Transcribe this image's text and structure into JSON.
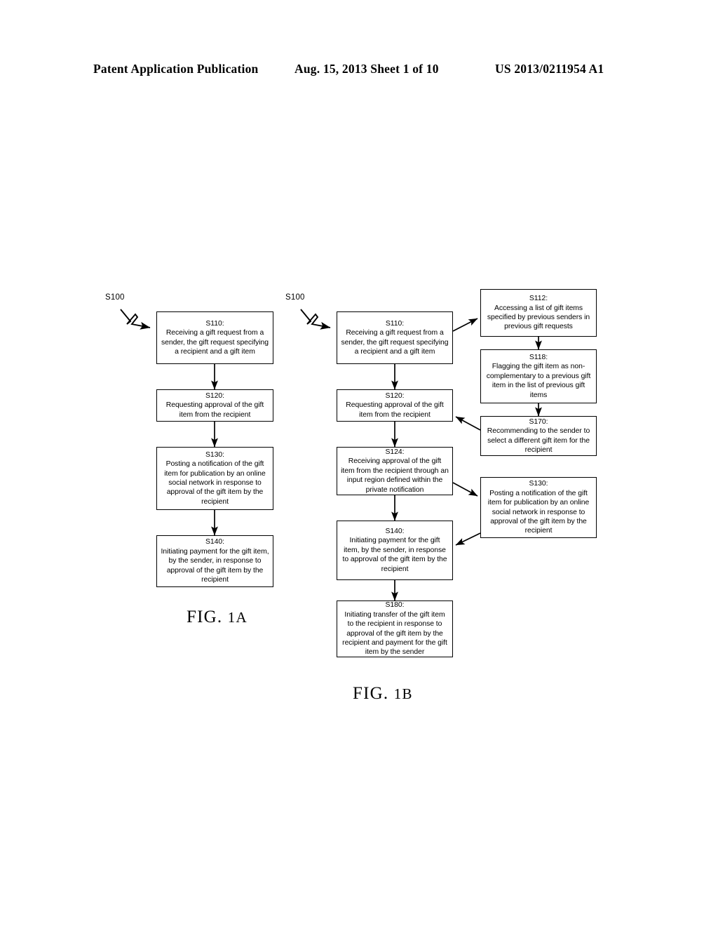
{
  "header": {
    "publication": "Patent Application Publication",
    "date_sheet": "Aug. 15, 2013  Sheet 1 of 10",
    "doc_number": "US 2013/0211954 A1"
  },
  "figures": [
    {
      "id": "fig-1a",
      "caption_prefix": "FIG. ",
      "caption_number": "1A",
      "ref_label": "S100",
      "boxes": [
        {
          "key": "s110",
          "step": "S110:",
          "text": "Receiving a gift request from a sender, the gift request specifying a recipient and a gift item"
        },
        {
          "key": "s120",
          "step": "S120:",
          "text": "Requesting approval of the gift item from the recipient"
        },
        {
          "key": "s130",
          "step": "S130:",
          "text": "Posting a notification of the gift item for publication by an online social network in response to approval of the gift item by the recipient"
        },
        {
          "key": "s140",
          "step": "S140:",
          "text": "Initiating payment for the gift item, by the sender, in response to approval of the gift item by the recipient"
        }
      ]
    },
    {
      "id": "fig-1b",
      "caption_prefix": "FIG. ",
      "caption_number": "1B",
      "ref_label": "S100",
      "boxes": [
        {
          "key": "s110",
          "step": "S110:",
          "text": "Receiving a gift request from a sender, the gift request specifying a recipient and a gift item"
        },
        {
          "key": "s120",
          "step": "S120:",
          "text": "Requesting approval of the gift item from the recipient"
        },
        {
          "key": "s124",
          "step": "S124:",
          "text": "Receiving approval of the gift item from the recipient through an input region defined within the private notification"
        },
        {
          "key": "s140",
          "step": "S140:",
          "text": "Initiating payment for the gift item, by the sender, in response to approval of the gift item by the recipient"
        },
        {
          "key": "s180",
          "step": "S180:",
          "text": "Initiating transfer of the gift item to the recipient in response to approval of the gift item by the recipient and payment for the gift item by the sender"
        },
        {
          "key": "s112",
          "step": "S112:",
          "text": "Accessing a list of gift items specified by previous senders in previous gift requests"
        },
        {
          "key": "s118",
          "step": "S118:",
          "text": "Flagging the gift item as non-complementary to a previous gift item in the list of previous gift items"
        },
        {
          "key": "s170",
          "step": "S170:",
          "text": "Recommending to the sender to select a different gift item for the recipient"
        },
        {
          "key": "s130r",
          "step": "S130:",
          "text": "Posting a notification of the gift item for publication by an online social network in response to approval of the gift item by the recipient"
        }
      ]
    }
  ],
  "colors": {
    "ink": "#000000",
    "paper": "#ffffff"
  }
}
